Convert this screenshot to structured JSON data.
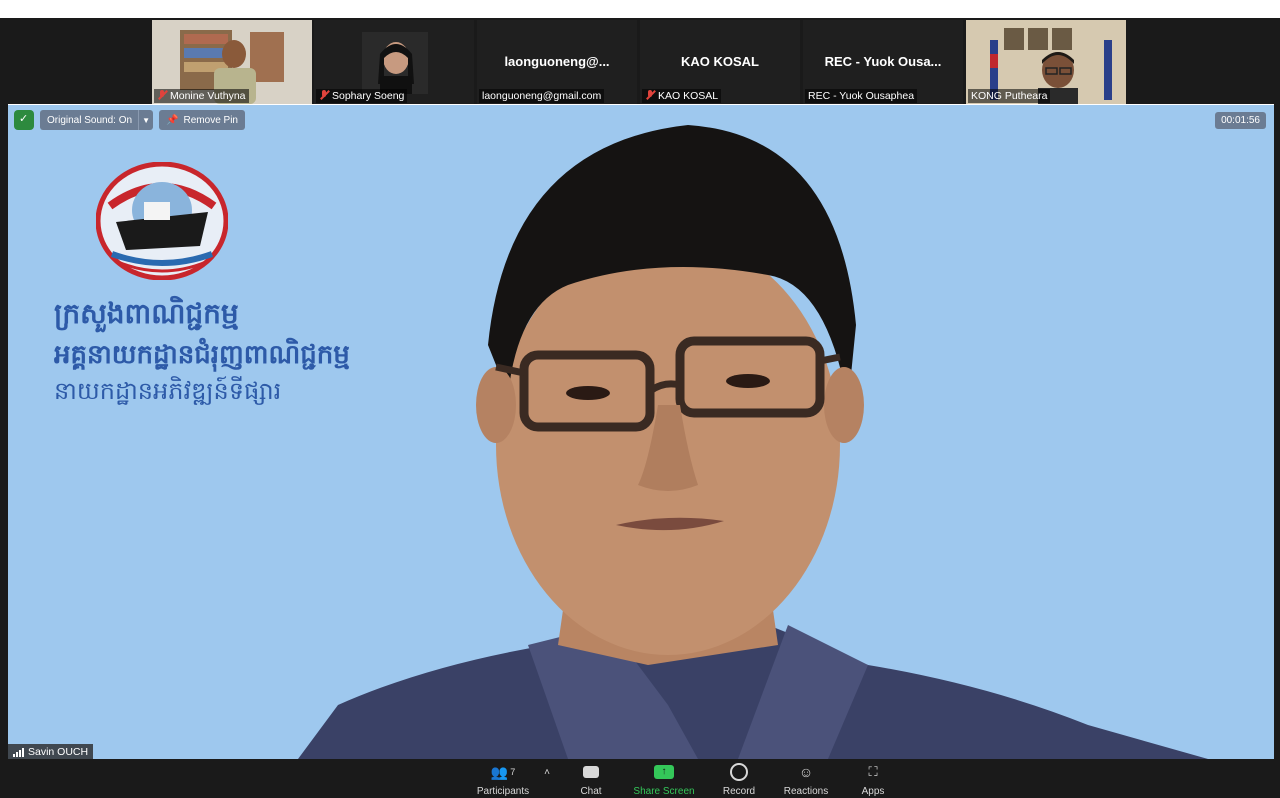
{
  "gallery": [
    {
      "caption": "Monine Vuthyna",
      "muted": true,
      "type": "video"
    },
    {
      "caption": "Sophary Soeng",
      "muted": true,
      "type": "video"
    },
    {
      "display": "laonguoneng@...",
      "caption": "laonguoneng@gmail.com",
      "muted": false,
      "type": "name"
    },
    {
      "display": "KAO KOSAL",
      "caption": "KAO KOSAL",
      "muted": true,
      "type": "name"
    },
    {
      "display": "REC - Yuok Ousa...",
      "caption": "REC - Yuok Ousaphea",
      "muted": false,
      "type": "name"
    },
    {
      "caption": "KONG Putheara",
      "muted": false,
      "type": "video"
    }
  ],
  "controls": {
    "original_sound": "Original Sound: On",
    "remove_pin": "Remove Pin",
    "timer": "00:01:56"
  },
  "main": {
    "line1": "ក្រសួងពាណិជ្ជកម្ម",
    "line2": "អគ្គនាយកដ្ឋានជំរុញពាណិជ្ជកម្ម",
    "line3": "នាយកដ្ឋានអភិវឌ្ឍន៍ទីផ្សារ",
    "speaker": "Savin OUCH"
  },
  "toolbar": {
    "participants_count": "7",
    "participants": "Participants",
    "chat": "Chat",
    "share": "Share Screen",
    "record": "Record",
    "reactions": "Reactions",
    "apps": "Apps"
  },
  "colors": {
    "background": "#9ec8ee",
    "khmer_text": "#2d5aa8",
    "share_green": "#34c759"
  }
}
